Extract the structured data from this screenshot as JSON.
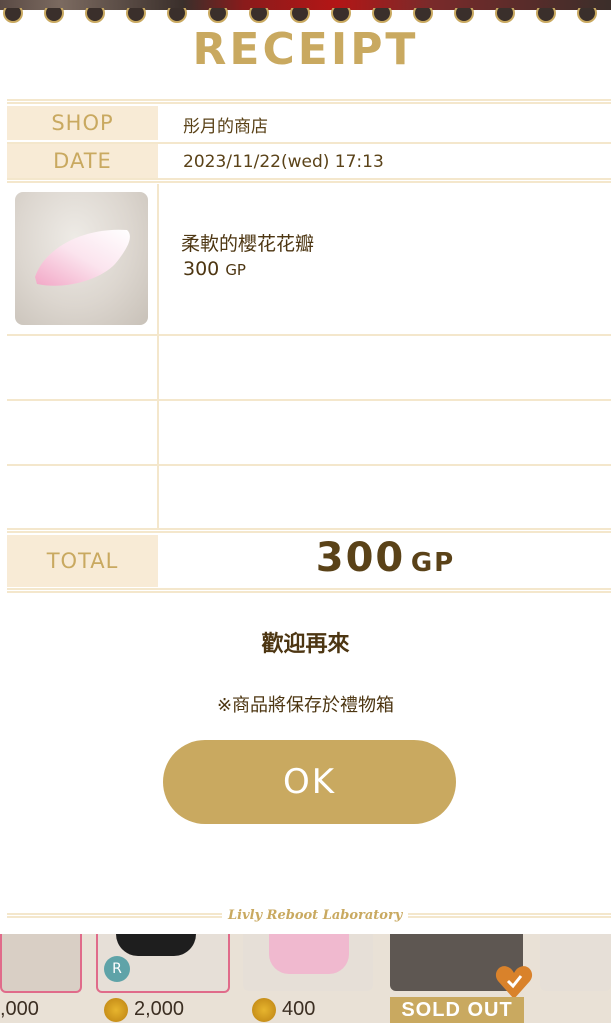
{
  "receipt": {
    "title": "RECEIPT",
    "shop_label": "SHOP",
    "shop_value": "彤月的商店",
    "date_label": "DATE",
    "date_value": "2023/11/22(wed) 17:13",
    "item": {
      "name": "柔軟的櫻花花瓣",
      "price": "300",
      "currency": "GP"
    },
    "total_label": "TOTAL",
    "total_value": "300",
    "total_currency": "GP",
    "welcome": "歡迎再來",
    "note": "※商品將保存於禮物箱",
    "ok_label": "OK",
    "footer_logo": "Livly Reboot Laboratory"
  },
  "background_shop": {
    "prices": [
      ",000",
      "2,000",
      "400"
    ],
    "rank_badge": "R",
    "sold_out": "SOLD OUT"
  },
  "colors": {
    "accent_gold": "#c9a960",
    "label_bg": "#f8ebd6",
    "text_brown": "#5a4218"
  }
}
